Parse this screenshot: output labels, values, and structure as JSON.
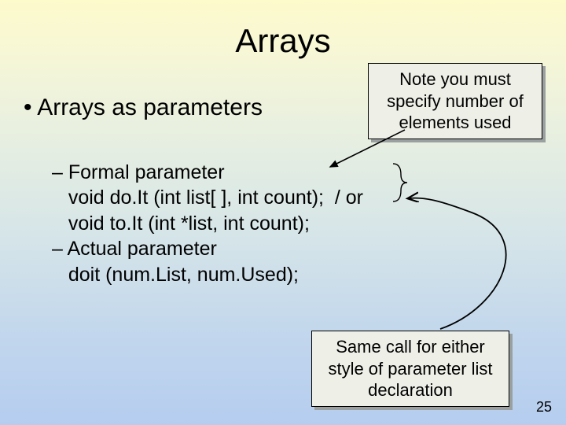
{
  "title": "Arrays",
  "bullet1_prefix": "• ",
  "bullet1": "Arrays as parameters",
  "body_lines": [
    "– Formal parameter",
    "   void do.It (int list[ ], int count);  / or",
    "   void to.It (int *list, int count);",
    "– Actual parameter",
    "   doit (num.List, num.Used);"
  ],
  "callout_top": "Note you must specify number of elements used",
  "callout_bottom": "Same call for either style of parameter list declaration",
  "page_number": "25"
}
